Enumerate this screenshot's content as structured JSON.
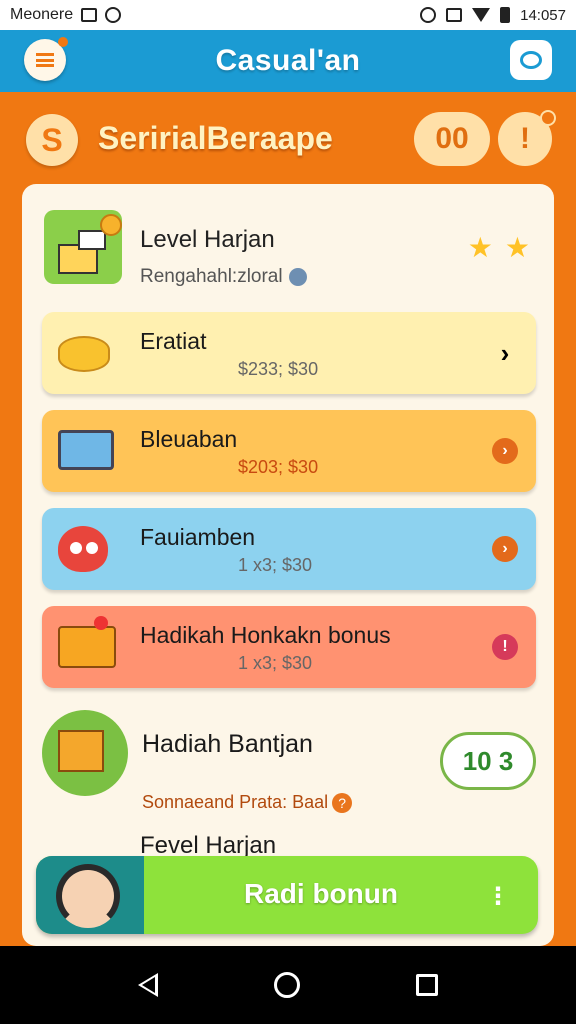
{
  "status_bar": {
    "carrier": "Meonere",
    "time": "14:057"
  },
  "app_bar": {
    "title": "Casual'an"
  },
  "header": {
    "section_title": "SeririalBeraape",
    "coin_letter": "S",
    "counter": "00",
    "alert_glyph": "!"
  },
  "level": {
    "title": "Level Harjan",
    "subtitle": "Rengahahl:zloral"
  },
  "rows": [
    {
      "label": "Eratiat",
      "price": "$233; $30",
      "arrow": "›",
      "color": "#fff0b0"
    },
    {
      "label": "Bleuaban",
      "price": "$203; $30",
      "arrow": "›",
      "color": "#ffc457"
    },
    {
      "label": "Fauiamben",
      "price": "1 x3; $30",
      "arrow": "›",
      "color": "#8dd2ef"
    },
    {
      "label": "Hadikah Honkakn bonus",
      "price": "1 x3; $30",
      "arrow": "!",
      "color": "#ff9271"
    }
  ],
  "gift": {
    "title": "Hadiah Bantjan",
    "subtitle": "Sonnaeand Prata: Baal",
    "question_glyph": "?",
    "score": "10 3"
  },
  "level2": {
    "title": "Fevel Harjan"
  },
  "cta": {
    "label": "Radi bonun",
    "dots": "⋮"
  },
  "icons": [
    "menu-icon",
    "profile-icon",
    "coin-icon",
    "alert-icon",
    "star-icon",
    "chevron-right-icon",
    "gift-icon",
    "avatar-icon",
    "back-icon",
    "home-icon",
    "recents-icon"
  ],
  "colors": {
    "orange": "#f07812",
    "blue": "#1b9bd3",
    "green": "#8ee23b",
    "teal": "#1d8c8a"
  }
}
